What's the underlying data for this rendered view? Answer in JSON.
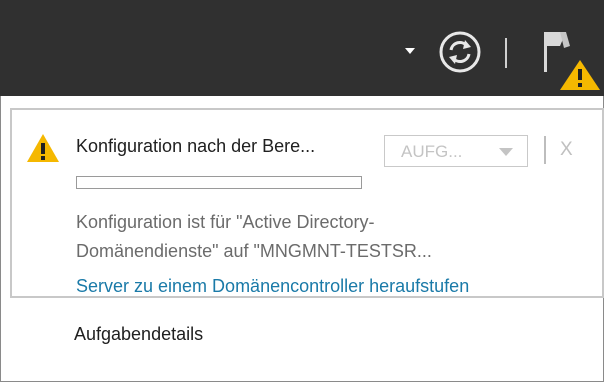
{
  "toolbar": {
    "icons": [
      "chevron-down-icon",
      "refresh-icon",
      "flag-icon",
      "warning-icon"
    ]
  },
  "notification": {
    "title": "Konfiguration nach der Bere...",
    "task_button_label": "AUFG...",
    "close_label": "X",
    "message_line1": "Konfiguration ist für \"Active Directory-",
    "message_line2": "Domänendienste\" auf \"MNGMNT-TESTSR...",
    "link_text": "Server zu einem Domänencontroller heraufstufen",
    "progress": 0
  },
  "footer": {
    "task_details": "Aufgabendetails"
  },
  "colors": {
    "toolbar_bg": "#303030",
    "warning": "#f5b800",
    "link": "#1a7aa8"
  }
}
